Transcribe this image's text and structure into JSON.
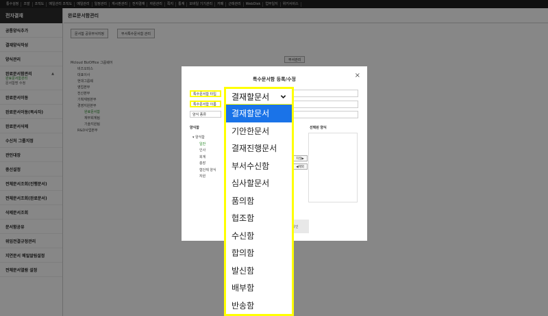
{
  "topnav": [
    "통수설정",
    "조발",
    "조직도",
    "메일관리 조직도",
    "메일관리",
    "일정관리",
    "게시판관리",
    "전자결재",
    "자원관리",
    "쪽지",
    "통계",
    "모바일 기기관리",
    "카페",
    "근태관리",
    "WebDisk",
    "업무일지",
    "위키서비스"
  ],
  "sidebar": {
    "header": "전자결재",
    "items": [
      {
        "label": "공통양식추가"
      },
      {
        "label": "결재양식작성"
      },
      {
        "label": "양식관리"
      },
      {
        "label": "완료문서함관리",
        "sub1": "완료문서함관리",
        "sub2": "문서함명 수정"
      },
      {
        "label": "완료문서이동"
      },
      {
        "label": "완료문서이동(복사자)"
      },
      {
        "label": "완료문서삭제"
      },
      {
        "label": "수신처 그룹지정"
      },
      {
        "label": "관인대장"
      },
      {
        "label": "중선설정"
      },
      {
        "label": "전체문서조회(진행문서)"
      },
      {
        "label": "전체문서조회(완료문서)"
      },
      {
        "label": "삭제문서조회"
      },
      {
        "label": "문서함공유"
      },
      {
        "label": "위임전결규정관리"
      },
      {
        "label": "지연문서 메일알림설정"
      },
      {
        "label": "전체문서열람 설정"
      }
    ]
  },
  "main": {
    "title": "완료문서함관리",
    "btn1": "문서함 공유부서지정",
    "btn2": "부서특수문서함 관리",
    "btn3": "부서관리",
    "tree": [
      "Mcloud BizOffice 그룹웨어",
      "비즈오피스",
      "대표이사",
      "현대그룹웨",
      "영업본부",
      "전산본부",
      "기획재정본부",
      "경영지원본부",
      "완료문서함",
      "재무회계팀",
      "기술지원팀",
      "R&D사업본부"
    ]
  },
  "modal": {
    "title": "특수문서함 등록/수정",
    "close": "×",
    "label_type": "특수문서함 타입",
    "label_name": "특수문서함 이름",
    "label_sort": "양식 종류",
    "left_section": "양식함",
    "right_section": "선택된 양식",
    "tree_root": "양식함",
    "tree": [
      "일반",
      "인사",
      "회계",
      "총장",
      "협단체 양식",
      "자원"
    ],
    "move_right": "지정▶",
    "move_left": "◀제외",
    "save": "확인"
  },
  "dropdown": {
    "selected": "결재할문서",
    "options": [
      "결재할문서",
      "기안한문서",
      "결재진행문서",
      "부서수신함",
      "심사할문서",
      "품의함",
      "협조함",
      "수신함",
      "합의함",
      "발신함",
      "배부함",
      "반송함"
    ]
  },
  "colors": {
    "highlight": "#ffff00",
    "selected_option": "#1a73e8",
    "sidebar_header": "#2d2d2d"
  }
}
